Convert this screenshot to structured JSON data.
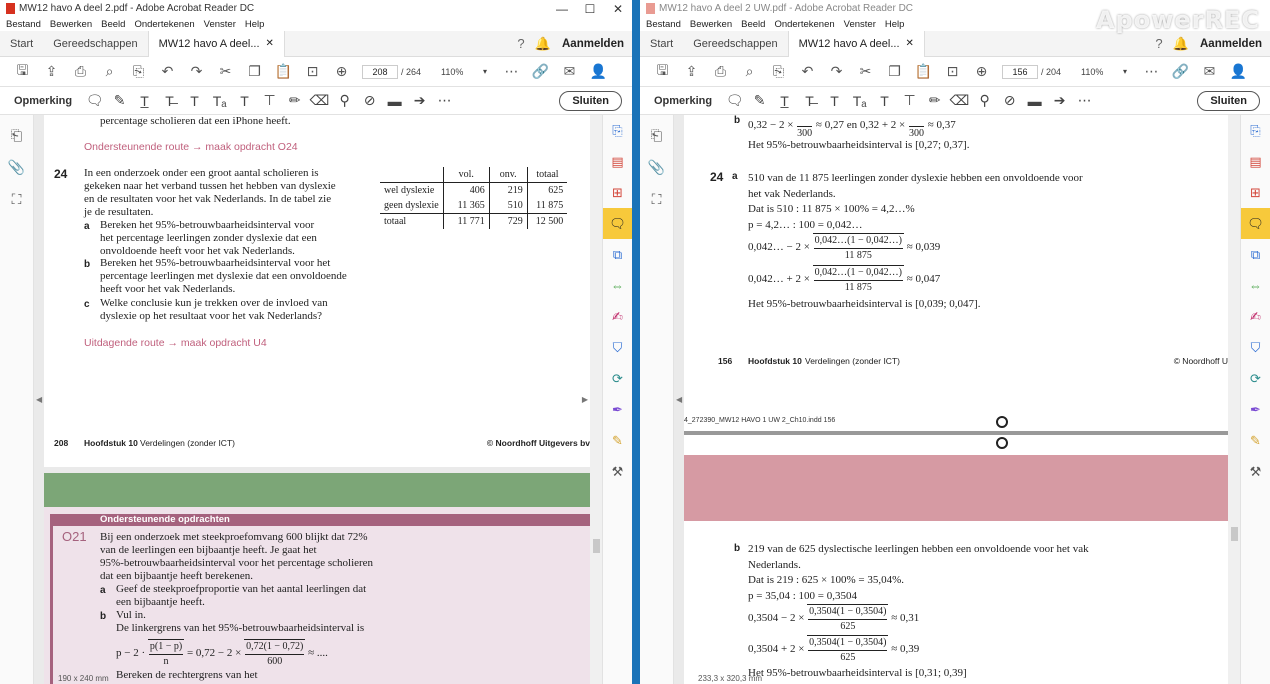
{
  "left_window": {
    "title": "MW12 havo A deel 2.pdf - Adobe Acrobat Reader DC",
    "menu": [
      "Bestand",
      "Bewerken",
      "Beeld",
      "Ondertekenen",
      "Venster",
      "Help"
    ],
    "tabs": {
      "start": "Start",
      "tools": "Gereedschappen",
      "doc": "MW12 havo A deel..."
    },
    "signin": "Aanmelden",
    "page_current": "208",
    "page_total": "/ 264",
    "zoom": "110%",
    "comment_label": "Opmerking",
    "close_label": "Sluiten",
    "status_size": "190 x 240 mm",
    "page": {
      "top_line": "percentage scholieren dat een iPhone heeft.",
      "route1": "Ondersteunende route → maak opdracht O24",
      "ex_num": "24",
      "ex_intro": [
        "In een onderzoek onder een groot aantal scholieren is",
        "gekeken naar het verband tussen het hebben van dyslexie",
        "en de resultaten voor het vak Nederlands. In de tabel zie",
        "je de resultaten."
      ],
      "qa_label": "a",
      "qa": [
        "Bereken het 95%-betrouwbaarheidsinterval voor",
        "het percentage leerlingen zonder dyslexie dat een",
        "onvoldoende heeft voor het vak Nederlands."
      ],
      "qb_label": "b",
      "qb": [
        "Bereken het 95%-betrouwbaarheidsinterval voor het",
        "percentage leerlingen met dyslexie dat een onvoldoende",
        "heeft voor het vak Nederlands."
      ],
      "qc_label": "c",
      "qc": [
        "Welke conclusie kun je trekken over de invloed van",
        "dyslexie op het resultaat voor het vak Nederlands?"
      ],
      "route2": "Uitdagende route → maak opdracht U4",
      "table": {
        "headers": [
          "",
          "vol.",
          "onv.",
          "totaal"
        ],
        "rows": [
          [
            "wel dyslexie",
            "406",
            "219",
            "625"
          ],
          [
            "geen dyslexie",
            "11 365",
            "510",
            "11 875"
          ],
          [
            "totaal",
            "11 771",
            "729",
            "12 500"
          ]
        ]
      },
      "footer_num": "208",
      "footer_chapter": "Hoofdstuk 10",
      "footer_title": "Verdelingen (zonder ICT)",
      "footer_publisher": "© Noordhoff Uitgevers bv",
      "box_header": "Ondersteunende opdrachten",
      "o21_num": "O21",
      "o21_text": [
        "Bij een onderzoek met steekproefomvang 600 blijkt dat 72%",
        "van de leerlingen een bijbaantje heeft. Je gaat het",
        "95%-betrouwbaarheidsinterval voor het percentage scholieren",
        "dat een bijbaantje heeft berekenen."
      ],
      "o21_a_label": "a",
      "o21_a": [
        "Geef de steekproefproportie van het aantal leerlingen dat",
        "een bijbaantje heeft."
      ],
      "o21_b_label": "b",
      "o21_b": "Vul in.",
      "o21_b2": "De linkergrens van het 95%-betrouwbaarheidsinterval is",
      "o21_formula_prefix": "p − 2 ·",
      "o21_formula_num1": "p(1 − p)",
      "o21_formula_den1": "n",
      "o21_formula_mid": "= 0,72 − 2 ×",
      "o21_formula_num2": "0,72(1 − 0,72)",
      "o21_formula_den2": "600",
      "o21_formula_end": "≈ ....",
      "o21_c_partial": "Bereken de rechtergrens van het"
    }
  },
  "right_window": {
    "title": "MW12 havo A deel 2 UW.pdf - Adobe Acrobat Reader DC",
    "menu": [
      "Bestand",
      "Bewerken",
      "Beeld",
      "Ondertekenen",
      "Venster",
      "Help"
    ],
    "tabs": {
      "start": "Start",
      "tools": "Gereedschappen",
      "doc": "MW12 havo A deel..."
    },
    "signin": "Aanmelden",
    "page_current": "156",
    "page_total": "/ 204",
    "zoom": "110%",
    "comment_label": "Opmerking",
    "close_label": "Sluiten",
    "status_size": "233,3 x 320,3 mm",
    "watermark": "ApowerREC",
    "page": {
      "top_b": "b",
      "top_formula_left": "0,32 − 2 ×",
      "top_den": "300",
      "top_formula_mid": "≈ 0,27 en 0,32 + 2 ×",
      "top_formula_end": "≈ 0,37",
      "top_interval": "Het 95%-betrouwbaarheidsinterval is [0,27; 0,37].",
      "ex_num": "24",
      "ex_a": "a",
      "a_line1": "510 van de 11 875 leerlingen zonder dyslexie hebben een onvoldoende voor",
      "a_line2": "het vak Nederlands.",
      "a_line3": "Dat is 510 : 11 875 × 100% = 4,2…%",
      "a_line4": "p = 4,2… : 100 = 0,042…",
      "a_f1_left": "0,042… − 2 ×",
      "a_f_num": "0,042…(1 − 0,042…)",
      "a_f_den": "11 875",
      "a_f1_res": "≈ 0,039",
      "a_f2_left": "0,042… + 2 ×",
      "a_f2_res": "≈ 0,047",
      "a_interval": "Het 95%-betrouwbaarheidsinterval is [0,039; 0,047].",
      "footer_num": "156",
      "footer_chapter": "Hoofdstuk 10",
      "footer_title": "Verdelingen (zonder ICT)",
      "footer_publisher": "© Noordhoff U",
      "slug": "4_272390_MW12 HAVO 1 UW 2_Ch10.indd 156",
      "ex_b": "b",
      "b_line1": "219 van de 625 dyslectische leerlingen hebben een onvoldoende voor het vak",
      "b_line2": "Nederlands.",
      "b_line3": "Dat is 219 : 625 × 100% = 35,04%.",
      "b_line4": "p = 35,04 : 100 = 0,3504",
      "b_f1_left": "0,3504 − 2 ×",
      "b_f_num": "0,3504(1 − 0,3504)",
      "b_f_den": "625",
      "b_f1_res": "≈ 0,31",
      "b_f2_left": "0,3504 + 2 ×",
      "b_f2_res": "≈ 0,39",
      "b_interval_partial": "Het 95%-betrouwbaarheidsinterval is [0,31; 0,39]"
    }
  },
  "colors": {
    "accent_pink": "#c0607d",
    "green_band": "#7ca677",
    "pink_band": "#d69aa3",
    "purple_header": "#a5627e",
    "comment_active": "#f7c93b"
  }
}
